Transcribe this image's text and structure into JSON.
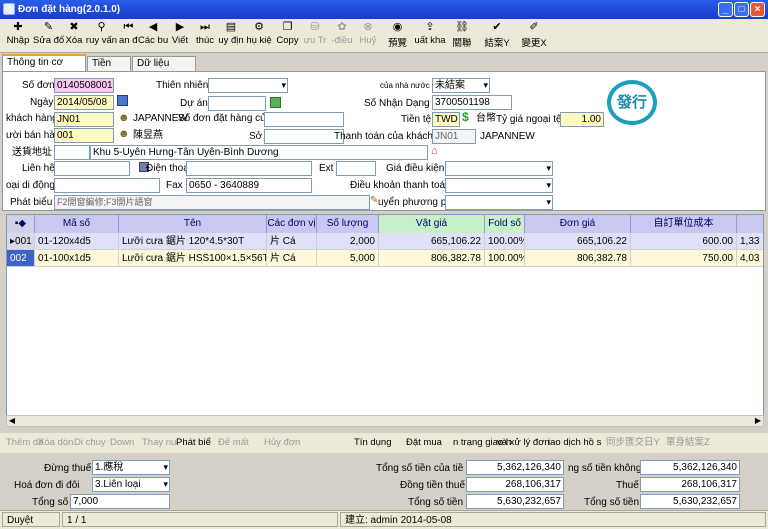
{
  "window": {
    "title": "Đơn đặt hàng(2.0.1.0)"
  },
  "toolbar": {
    "items": [
      {
        "label": "Nhập",
        "icon": "new-icon"
      },
      {
        "label": "Sửa đổ",
        "icon": "edit-icon"
      },
      {
        "label": "Xóa",
        "icon": "delete-icon"
      },
      {
        "label": "ruy vấn",
        "icon": "search-icon"
      },
      {
        "label": "an đầu",
        "icon": "first-icon"
      },
      {
        "label": "Các bư",
        "icon": "prev-icon"
      },
      {
        "label": "Viết",
        "icon": "next-icon"
      },
      {
        "label": "thúc",
        "icon": "last-icon"
      },
      {
        "label": "uy địn",
        "icon": "rule-icon"
      },
      {
        "label": "hụ kiệ",
        "icon": "attach-icon"
      },
      {
        "label": "Copy",
        "icon": "copy-icon"
      },
      {
        "label": "ưu Tr",
        "icon": "save-icon"
      },
      {
        "label": "-điều",
        "icon": "adjust-icon"
      },
      {
        "label": "Huỷ",
        "icon": "cancel-icon"
      },
      {
        "label": "預覽",
        "icon": "preview-icon"
      },
      {
        "label": "uất kha",
        "icon": "export-icon"
      },
      {
        "label": "關聯",
        "icon": "link-icon"
      },
      {
        "label": "結案Y",
        "icon": "close-case-icon"
      },
      {
        "label": "變更X",
        "icon": "change-icon"
      }
    ]
  },
  "tabs": [
    "Thông tin cơ bản",
    "Tiền gửi",
    "Dữ liệu Xem"
  ],
  "form": {
    "so_don_label": "Số đơn",
    "so_don": "0140508001",
    "thien_nhien_label": "Thiên nhiên",
    "thien_nhien": "",
    "cua_nha_nuoc_label": "của nhà nước",
    "cua_nha_nuoc": "未結案",
    "ngay_label": "Ngày",
    "ngay": "2014/05/08",
    "du_an_label": "Dự án",
    "du_an": "",
    "so_nhan_dang_label": "Số Nhận Dạng",
    "so_nhan_dang": "3700501198",
    "khach_hang_label": "khách hàng",
    "khach_hang": "JN01",
    "khach_hang_name": "JAPANNEW",
    "don_dat_hang_label": "Số đơn đặt hàng của",
    "don_dat_hang": "",
    "tien_te_label": "Tiền tệ",
    "tien_te": "TWD",
    "tien_te_name": "台幣",
    "ty_gia_label": "Tỷ giá ngoại tệ",
    "ty_gia": "1.00",
    "ban_hang_label": "ười bán hàng",
    "ban_hang": "001",
    "ban_hang_name": "陳昱燕",
    "so_label": "Sở",
    "so": "",
    "thanh_toan_label": "Thanh toán của khách",
    "thanh_toan": "JN01",
    "thanh_toan_name": "JAPANNEW",
    "dia_chi_label": "送貨地址",
    "dia_chi": "Khu 5-Uyên Hưng-Tân Uyên-Bình Dương",
    "lien_he_label": "Liên hệ",
    "lien_he": "",
    "dien_thoai_label": "Điện thoại",
    "dien_thoai": "",
    "ext_label": "Ext",
    "ext": "",
    "gia_dieu_kien_label": "Giá điều kiện",
    "gia_dieu_kien": "",
    "di_dong_label": "oại di động",
    "di_dong": "",
    "fax_label": "Fax",
    "fax": "0650 - 3640889",
    "dieu_khoan_label": "Điều khoản thanh toá",
    "dieu_khoan": "",
    "phat_bieu_label": "Phát biểu",
    "phat_bieu": "F2開窗編修;F3開片語窗",
    "phuong_phap_label": "uyển phương ph",
    "phuong_phap": "",
    "stamp": "發行"
  },
  "grid": {
    "headers": [
      "Mã số",
      "Tên",
      "Các đơn vị",
      "Số lượng",
      "Vật giá",
      "Fold số",
      "Đơn giá",
      "自訂單位成本"
    ],
    "rows": [
      {
        "no": "001",
        "code": "01-120x4d5",
        "name": "Lưỡi cưa 鋸片 120*4.5*30T",
        "unit": "片 Cá",
        "qty": "2,000",
        "price": "665,106.22",
        "fold": "100.00%",
        "unit_price": "665,106.22",
        "cost": "600.00",
        "extra": "1,33"
      },
      {
        "no": "002",
        "code": "01-100x1d5",
        "name": "Lưỡi cưa 鋸片 HSS100×1.5×56T",
        "unit": "片 Cá",
        "qty": "5,000",
        "price": "806,382.78",
        "fold": "100.00%",
        "unit_price": "806,382.78",
        "cost": "750.00",
        "extra": "4,03"
      }
    ]
  },
  "bottombar": {
    "items": [
      "Thêm dò",
      "Xóa dòn",
      "Di chuy",
      "Down",
      "Thay nu",
      "Phát biể",
      "Để mất",
      "Hủy đơn",
      "Tín dụng",
      "Đặt mua",
      "n trạng giao h",
      "và xử lý đơn",
      "iao dịch hồ s",
      "同步匯交日Y",
      "單身結案Z"
    ]
  },
  "summary": {
    "dung_thue_label": "Đừng thuế",
    "dung_thue": "1.應稅",
    "hoa_don_label": "Hoá đơn đi đôi",
    "hoa_don": "3.Liên loại",
    "tong_so_label": "Tổng số",
    "tong_so": "7,000",
    "tong_tien_cua_tie_label": "Tổng số tiền của tiề",
    "tong_tien_cua_tie": "5,362,126,340",
    "dong_tien_thue_label": "Đồng tiền thuế",
    "dong_tien_thue": "268,106,317",
    "tong_so_tien_label": "Tổng số tiền",
    "tong_so_tien": "5,630,232,657",
    "tong_khong_label": "ng số tiền không p",
    "tong_khong": "5,362,126,340",
    "thue_label": "Thuế",
    "thue": "268,106,317",
    "tong_so_tien2_label": "Tổng số tiền",
    "tong_so_tien2": "5,630,232,657"
  },
  "status": {
    "mode": "Duyệt",
    "page": "1 / 1",
    "creator": "建立: admin 2014-05-08"
  }
}
